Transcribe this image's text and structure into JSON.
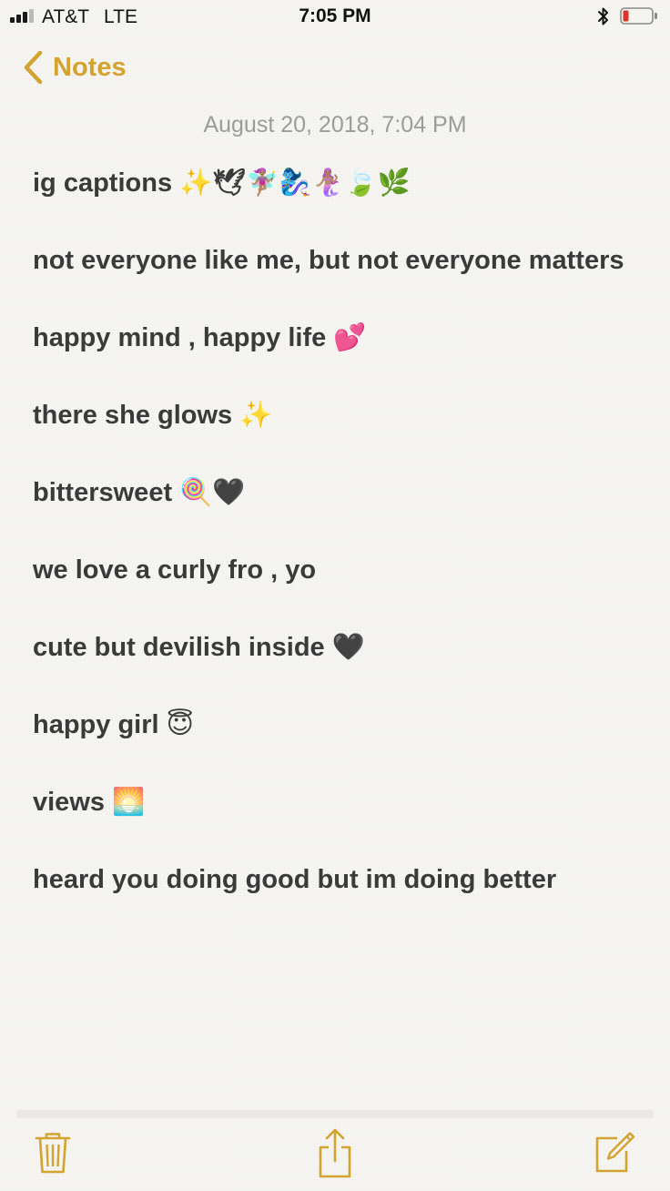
{
  "status_bar": {
    "carrier": "AT&T",
    "network": "LTE",
    "time": "7:05 PM",
    "signal_bars_filled": 3,
    "signal_bars_total": 4,
    "battery_level": "low",
    "battery_color": "#e0332c"
  },
  "nav": {
    "back_label": "Notes",
    "accent_color": "#d4a22f"
  },
  "note": {
    "date": "August 20, 2018, 7:04 PM",
    "lines": [
      "ig captions ✨🕊🧚🏽‍♀️🧞‍♀️🧜🏽‍♀️🍃🌿",
      "",
      "not everyone like me, but not everyone matters",
      "",
      "happy mind , happy life 💕",
      "",
      "there she glows ✨",
      "",
      "bittersweet 🍭🖤",
      "",
      "we love a curly fro , yo",
      "",
      "cute but devilish inside 🖤",
      "",
      "happy girl 😇",
      "",
      "views 🌅",
      "",
      "heard you doing good but im doing better"
    ]
  },
  "toolbar": {
    "icons": [
      "trash-icon",
      "share-icon",
      "compose-icon"
    ]
  }
}
